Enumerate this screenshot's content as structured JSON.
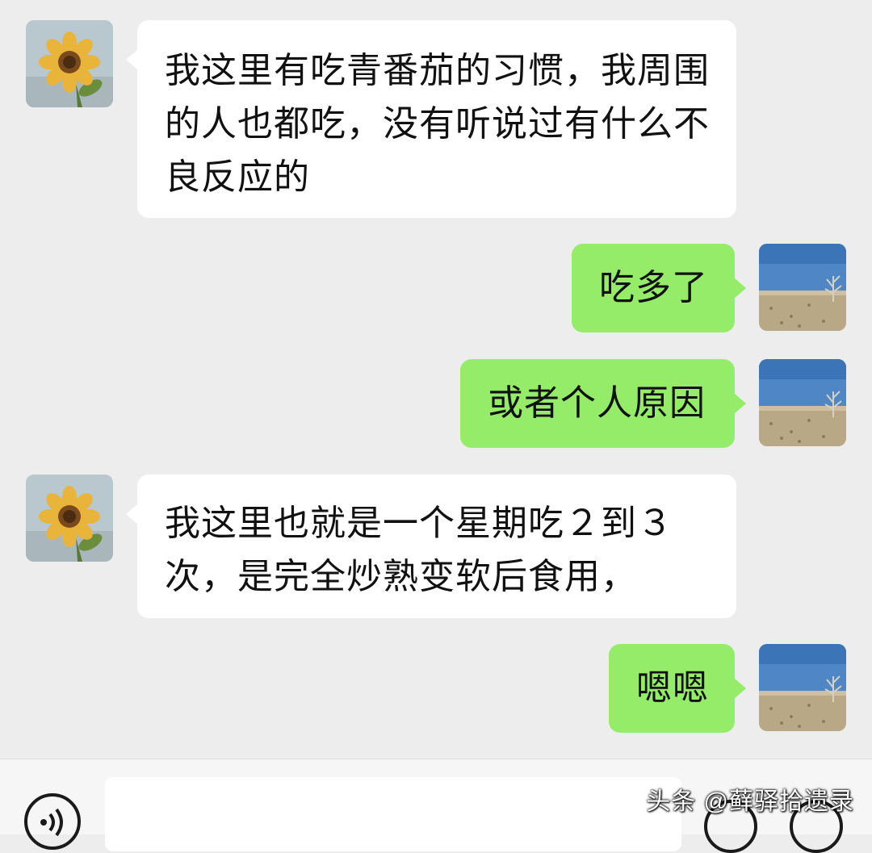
{
  "chat": {
    "messages": [
      {
        "direction": "in",
        "text": "我这里有吃青番茄的习惯，我周围的人也都吃，没有听说过有什么不良反应的"
      },
      {
        "direction": "out",
        "text": "吃多了"
      },
      {
        "direction": "out",
        "text": "或者个人原因"
      },
      {
        "direction": "in",
        "text": "我这里也就是一个星期吃２到３次，是完全炒熟变软后食用，"
      },
      {
        "direction": "out",
        "text": "嗯嗯"
      }
    ]
  },
  "avatars": {
    "contact": "sunflower-avatar",
    "self": "desert-landscape-avatar"
  },
  "input_bar": {
    "voice_icon": "voice-icon",
    "emoji_icon": "emoji-icon",
    "plus_icon": "plus-icon"
  },
  "watermark": {
    "text": "头条 @藓驿拾遗录"
  },
  "colors": {
    "background": "#ededed",
    "incoming_bubble": "#ffffff",
    "outgoing_bubble": "#95ec69",
    "input_bar": "#f6f6f6"
  }
}
